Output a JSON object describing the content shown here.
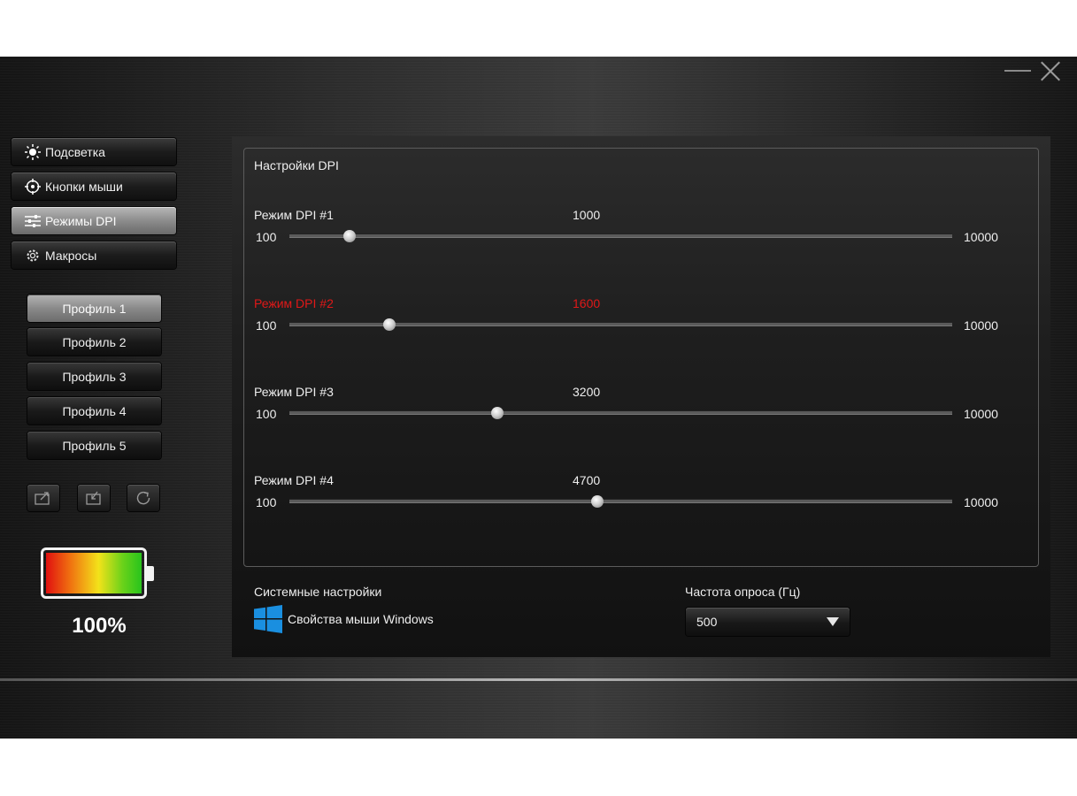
{
  "nav": {
    "items": [
      {
        "label": "Подсветка",
        "icon": "sun-icon",
        "active": false
      },
      {
        "label": "Кнопки мыши",
        "icon": "crosshair-icon",
        "active": false
      },
      {
        "label": "Режимы DPI",
        "icon": "sliders-icon",
        "active": true
      },
      {
        "label": "Макросы",
        "icon": "gear-icon",
        "active": false
      }
    ]
  },
  "profiles": {
    "items": [
      {
        "label": "Профиль 1",
        "active": true
      },
      {
        "label": "Профиль 2",
        "active": false
      },
      {
        "label": "Профиль 3",
        "active": false
      },
      {
        "label": "Профиль 4",
        "active": false
      },
      {
        "label": "Профиль 5",
        "active": false
      }
    ]
  },
  "actions": {
    "icons": [
      "export-icon",
      "import-icon",
      "reset-icon"
    ]
  },
  "battery": {
    "level": 100,
    "label": "100%"
  },
  "dpi": {
    "title": "Настройки DPI",
    "min_label": "100",
    "max_label": "10000",
    "min": 100,
    "max": 10000,
    "modes": [
      {
        "label": "Режим DPI #1",
        "value_text": "1000",
        "value": 1000,
        "selected": false
      },
      {
        "label": "Режим DPI #2",
        "value_text": "1600",
        "value": 1600,
        "selected": true
      },
      {
        "label": "Режим DPI #3",
        "value_text": "3200",
        "value": 3200,
        "selected": false
      },
      {
        "label": "Режим DPI #4",
        "value_text": "4700",
        "value": 4700,
        "selected": false
      }
    ]
  },
  "system": {
    "title": "Системные настройки",
    "link_label": "Свойства мыши Windows",
    "icon": "windows-logo-icon"
  },
  "polling": {
    "title": "Частота опроса (Гц)",
    "value": "500"
  },
  "colors": {
    "selected_mode": "#e01818",
    "windows_blue": "#1a8fe0"
  }
}
